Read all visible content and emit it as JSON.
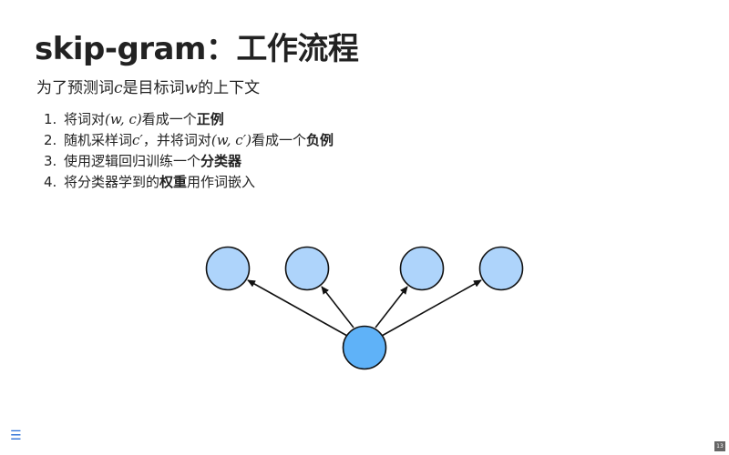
{
  "slide": {
    "title": "skip-gram：工作流程",
    "subtitle": {
      "part1": "为了预测词",
      "var1": "c",
      "part2": "是目标词",
      "var2": "w",
      "part3": "的上下文"
    },
    "steps": [
      {
        "number": "1.",
        "text1": "将词对",
        "math1": "(w, c)",
        "text2": "看成一个",
        "bold": "正例"
      },
      {
        "number": "2.",
        "text1": "随机采样词",
        "math1": "c′",
        "text2": "，并将词对",
        "math2": "(w, c′)",
        "text3": "看成一个",
        "bold": "负例"
      },
      {
        "number": "3.",
        "text1": "使用逻辑回归训练一个",
        "bold": "分类器"
      },
      {
        "number": "4.",
        "text1": "将分类器学到的",
        "bold": "权重",
        "text2": "用作词嵌入"
      }
    ],
    "page_number": "13"
  },
  "diagram": {
    "context_node_count": 4,
    "colors": {
      "context_fill": "#aed4fb",
      "center_fill": "#5fb2f8",
      "stroke": "#111111"
    }
  },
  "icons": {
    "menu": "menu-icon"
  }
}
